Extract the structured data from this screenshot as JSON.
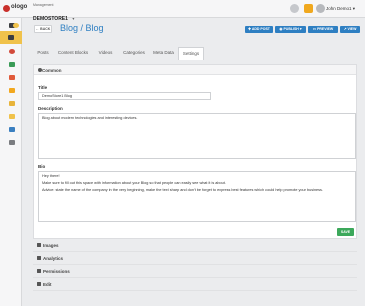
{
  "topbar": {
    "logo_text": "ologo",
    "store_label": "Management",
    "store_name": "DEMOSTORE1",
    "store_caret": "▾",
    "user_name": "John Demo1",
    "user_caret": "▾"
  },
  "colors": {
    "accent": "#2e7fc2",
    "active_nav": "#f0c24b",
    "success": "#3ca85b",
    "logo_red": "#c9302c"
  },
  "sidebar": {
    "items": [
      {
        "icon": "grid-icon"
      },
      {
        "icon": "star-icon"
      },
      {
        "icon": "pencil-icon"
      },
      {
        "icon": "palette-icon"
      },
      {
        "icon": "chart-icon"
      },
      {
        "icon": "apps-icon"
      },
      {
        "icon": "cart-icon"
      },
      {
        "icon": "people-icon"
      },
      {
        "icon": "tag-icon"
      },
      {
        "icon": "monitor-icon"
      },
      {
        "icon": "book-icon"
      }
    ]
  },
  "header": {
    "back_label": "BACK",
    "title": "Blog / Blog",
    "add_post_label": "ADD POST",
    "publish_label": "PUBLISH",
    "preview_label": "PREVIEW",
    "view_label": "VIEW"
  },
  "tabs": [
    {
      "label": "Posts"
    },
    {
      "label": "Content Blocks"
    },
    {
      "label": "Videos"
    },
    {
      "label": "Categories"
    },
    {
      "label": "Meta Data"
    },
    {
      "label": "Settings",
      "active": true
    }
  ],
  "common": {
    "title": "Common",
    "title_label": "Title",
    "title_value": "DemoStore1 Blog",
    "description_label": "Description",
    "description_value": "Blog about modern technologies and interesting devices.",
    "bio_label": "Bio",
    "bio_line1": "Hey there!",
    "bio_line2": "Make sure to fill out this space with information about your Blog so that people can easily see what it is about.",
    "bio_line3": "Advice: state the name of the company in the very beginning, make the text sharp and don't be forget to express best features which could help promote your business.",
    "save_label": "SAVE"
  },
  "sections": [
    {
      "label": "Images",
      "icon": "image-icon"
    },
    {
      "label": "Analytics",
      "icon": "analytics-icon"
    },
    {
      "label": "Permissions",
      "icon": "lock-icon"
    },
    {
      "label": "Edit",
      "icon": "wrench-icon"
    }
  ]
}
